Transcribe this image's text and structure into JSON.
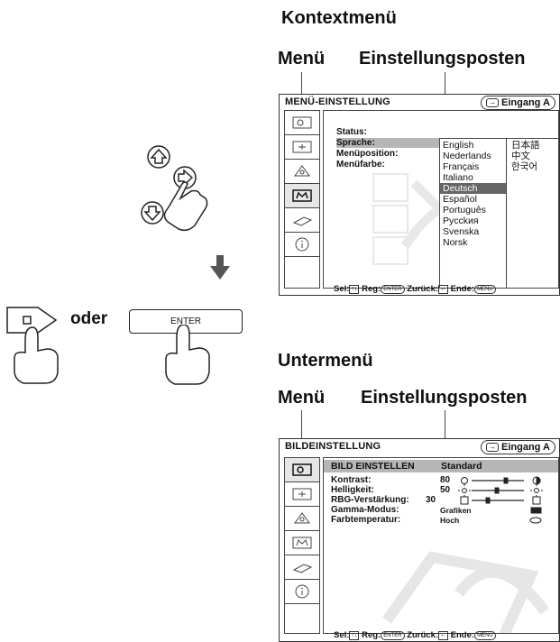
{
  "context_menu": {
    "heading": "Kontextmenü",
    "label_menu": "Menü",
    "label_items": "Einstellungsposten",
    "title": "MENÜ-EINSTELLUNG",
    "input": "Eingang A",
    "items": [
      "Status:",
      "Sprache:",
      "Menüposition:",
      "Menüfarbe:"
    ],
    "languages_col1": [
      "English",
      "Nederlands",
      "Français",
      "Italiano",
      "Deutsch",
      "Español",
      "Português",
      "Pycckия",
      "Svenska",
      "Norsk"
    ],
    "languages_col2": [
      "日本語",
      "中文",
      "한국어"
    ],
    "selected_language": "Deutsch",
    "footer": {
      "sel": "Sel:",
      "reg": "Reg:",
      "enter_key": "ENTER",
      "back": "Zurück:",
      "end": "Ende:",
      "menu_key": "MENU"
    }
  },
  "sub_menu": {
    "heading": "Untermenü",
    "label_menu": "Menü",
    "label_items": "Einstellungsposten",
    "title": "BILDEINSTELLUNG",
    "input": "Eingang A",
    "header_item": "BILD EINSTELLEN",
    "header_value": "Standard",
    "rows": [
      {
        "label": "Kontrast:",
        "value": "80"
      },
      {
        "label": "Helligkeit:",
        "value": "50"
      },
      {
        "label": "RBG-Verstärkung:",
        "value": "30"
      },
      {
        "label": "Gamma-Modus:",
        "value": "Grafiken"
      },
      {
        "label": "Farbtemperatur:",
        "value": "Hoch"
      }
    ],
    "footer": {
      "sel": "Sel:",
      "reg": "Reg:",
      "enter_key": "ENTER",
      "back": "Zurück:",
      "end": "Ende:",
      "menu_key": "MENU"
    }
  },
  "controls": {
    "oder": "oder",
    "enter": "ENTER",
    "icons": [
      "up-arrow-icon",
      "right-arrow-icon",
      "down-arrow-icon",
      "hand-pointer-icon"
    ]
  }
}
